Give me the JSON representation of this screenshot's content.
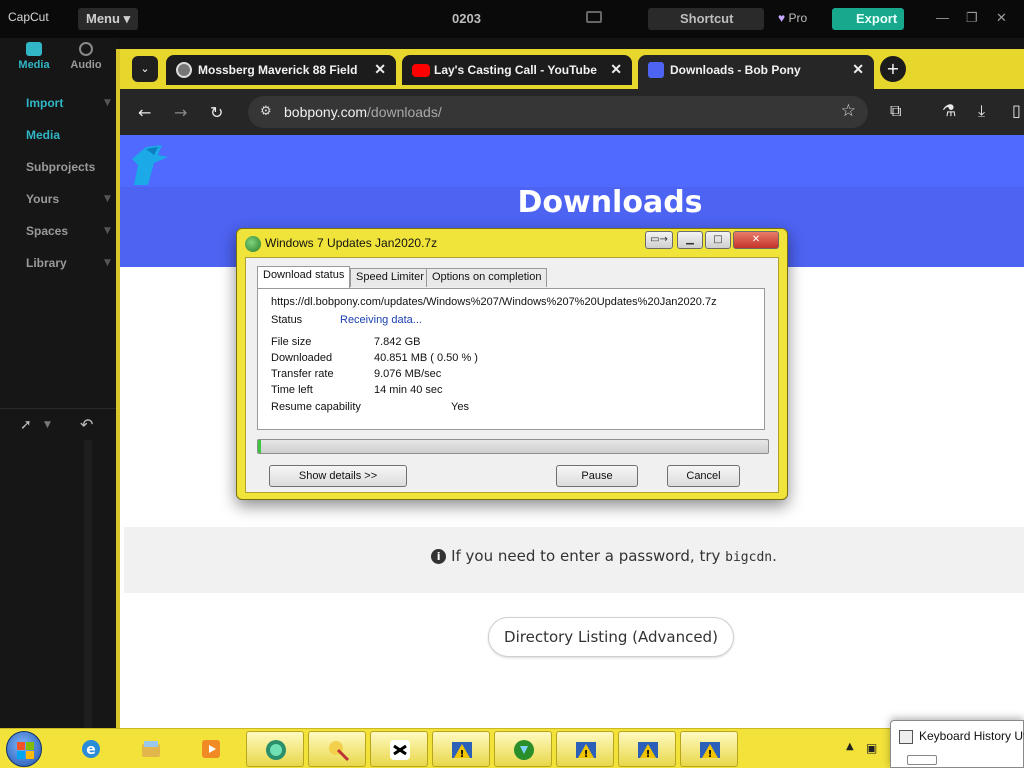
{
  "capcut": {
    "app_name": "CapCut",
    "menu_label": "Menu",
    "project_name": "0203",
    "shortcut_label": "Shortcut",
    "pro_label": "Pro",
    "export_label": "Export",
    "tabs": [
      {
        "label": "Media"
      },
      {
        "label": "Audio"
      }
    ],
    "nav": [
      {
        "label": "Import",
        "active": true
      },
      {
        "label": "Media",
        "active": true
      },
      {
        "label": "Subprojects"
      },
      {
        "label": "Yours"
      },
      {
        "label": "Spaces"
      },
      {
        "label": "Library"
      }
    ],
    "accent": "#31b6c5",
    "export_color": "#18a88e"
  },
  "browser": {
    "tabs": [
      {
        "title": "Mossberg Maverick 88 Field",
        "favicon": "target-icon"
      },
      {
        "title": "Lay's Casting Call - YouTube",
        "favicon": "youtube-icon"
      },
      {
        "title": "Downloads - Bob Pony",
        "favicon": "bobpony-icon",
        "active": true
      }
    ],
    "url_host": "bobpony.com",
    "url_path": "/downloads/"
  },
  "page": {
    "heading": "Downloads",
    "notice_prefix": "If you need to enter a password, try",
    "notice_code": "bigcdn",
    "notice_suffix": ".",
    "dir_button": "Directory Listing (Advanced)",
    "hero_color": "#4d63f2"
  },
  "dialog": {
    "title": "Windows 7 Updates Jan2020.7z",
    "tabs": [
      "Download status",
      "Speed Limiter",
      "Options on completion"
    ],
    "url": "https://dl.bobpony.com/updates/Windows%207/Windows%207%20Updates%20Jan2020.7z",
    "status_label": "Status",
    "status_value": "Receiving data...",
    "rows": [
      {
        "label": "File size",
        "value": "7.842  GB"
      },
      {
        "label": "Downloaded",
        "value": "40.851  MB  ( 0.50 % )"
      },
      {
        "label": "Transfer rate",
        "value": "9.076  MB/sec"
      },
      {
        "label": "Time left",
        "value": "14 min 40 sec"
      }
    ],
    "resume_label": "Resume capability",
    "resume_value": "Yes",
    "progress_fraction": 0.005,
    "buttons": {
      "details": "Show details >>",
      "pause": "Pause",
      "cancel": "Cancel"
    }
  },
  "taskbar": {
    "items": [
      {
        "icon": "ie-icon"
      },
      {
        "icon": "explorer-icon"
      },
      {
        "icon": "media-player-icon"
      },
      {
        "icon": "app-icon"
      },
      {
        "icon": "paint-icon"
      },
      {
        "icon": "capcut-icon"
      },
      {
        "icon": "warning-app-icon"
      },
      {
        "icon": "idm-icon"
      },
      {
        "icon": "warning-app-icon"
      },
      {
        "icon": "warning-app-icon"
      },
      {
        "icon": "warning-app-icon"
      }
    ],
    "popup_title": "Keyboard History Ut"
  }
}
